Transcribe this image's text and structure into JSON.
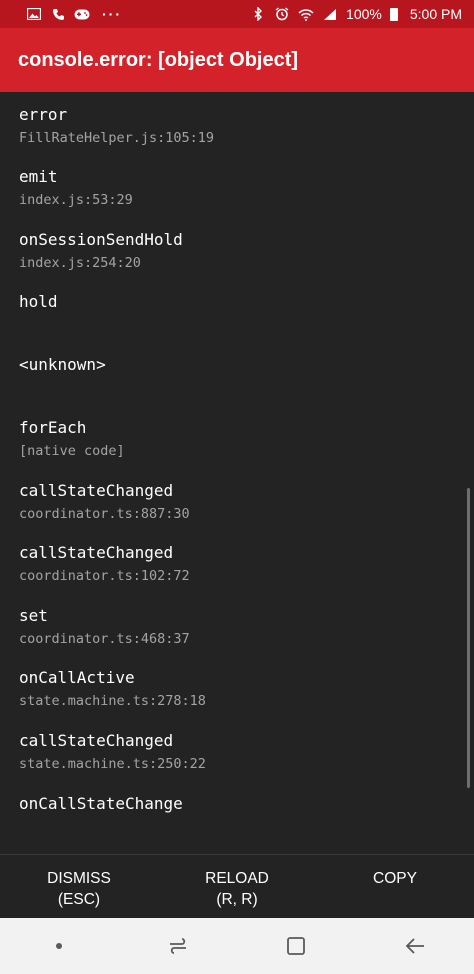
{
  "status_bar": {
    "battery_text": "100%",
    "time": "5:00 PM",
    "left_icons": [
      "image-icon",
      "phone-icon",
      "gamepad-icon",
      "more-icon"
    ],
    "right_icons": [
      "bluetooth-icon",
      "alarm-icon",
      "wifi-icon",
      "signal-icon",
      "battery-icon"
    ],
    "more_label": "···"
  },
  "header": {
    "title": "console.error: [object Object]",
    "color": "#d4222b"
  },
  "stack": [
    {
      "name": "error",
      "file": "FillRateHelper.js:105:19"
    },
    {
      "name": "emit",
      "file": "index.js:53:29"
    },
    {
      "name": "onSessionSendHold",
      "file": "index.js:254:20"
    },
    {
      "name": "hold",
      "file": ""
    },
    {
      "name": "<unknown>",
      "file": ""
    },
    {
      "name": "forEach",
      "file": "[native code]"
    },
    {
      "name": "callStateChanged",
      "file": "coordinator.ts:887:30"
    },
    {
      "name": "callStateChanged",
      "file": "coordinator.ts:102:72"
    },
    {
      "name": "set",
      "file": "coordinator.ts:468:37"
    },
    {
      "name": "onCallActive",
      "file": "state.machine.ts:278:18"
    },
    {
      "name": "callStateChanged",
      "file": "state.machine.ts:250:22"
    },
    {
      "name": "onCallStateChange",
      "file": ""
    }
  ],
  "footer": {
    "dismiss": {
      "label": "DISMISS",
      "shortcut": "(ESC)"
    },
    "reload": {
      "label": "RELOAD",
      "shortcut": "(R, R)"
    },
    "copy": {
      "label": "COPY",
      "shortcut": ""
    }
  },
  "nav_bar": {
    "icons": [
      "dot-icon",
      "recent-apps-icon",
      "home-icon",
      "back-icon"
    ]
  }
}
